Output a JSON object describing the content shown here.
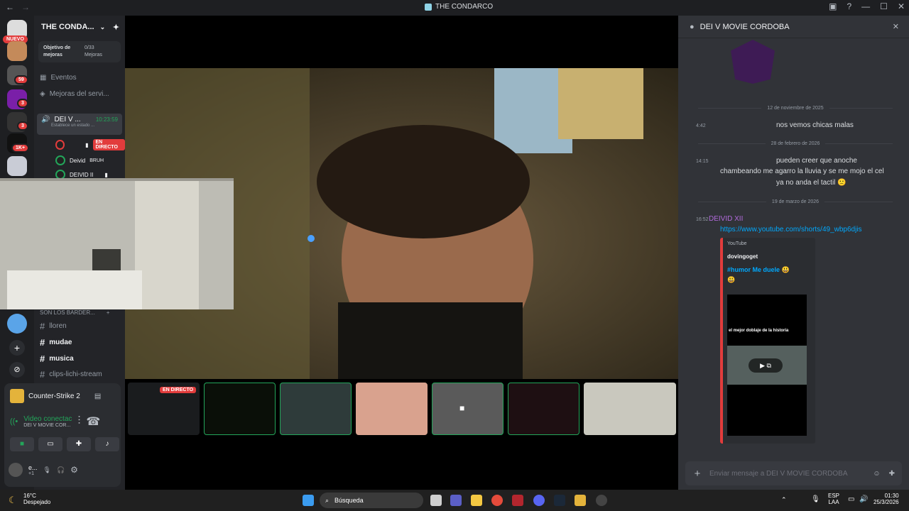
{
  "window": {
    "title": "THE CONDARCO"
  },
  "guilds": {
    "nuevo_label": "NUEVO",
    "badges": [
      "59",
      "3",
      "3",
      "1K+"
    ]
  },
  "server": {
    "name": "THE CONDA...",
    "boost_title": "Objetivo de mejoras",
    "boost_count": "0/33",
    "boost_unit": "Mejoras",
    "events": "Eventos",
    "upgrades": "Mejoras del servi...",
    "voice_channel": "DEI V ...",
    "voice_time": "10:23:59",
    "voice_status": "Establece un estado ...",
    "live_label": "EN DIRECTO",
    "members": [
      {
        "name": "Deivid",
        "status": "BRUH"
      },
      {
        "name": "DEIVID II",
        "status": ""
      }
    ],
    "category": "SON LOS BARDER...",
    "text_channels": [
      "lloren",
      "mudae",
      "musica",
      "clips-lichi-stream"
    ]
  },
  "activity": {
    "game": "Counter-Strike 2"
  },
  "voice_panel": {
    "status": "Video conectac",
    "channel": "DEI V MOVIE COR..."
  },
  "user": {
    "name": "e...",
    "sub": "+1"
  },
  "stage": {
    "thumb_live": "EN DIRECTO"
  },
  "chat": {
    "title": "DEI V MOVIE CORDOBA",
    "date1": "12 de noviembre de 2025",
    "msg1_time": "4:42",
    "msg1_text": "nos vemos chicas malas",
    "date2": "28 de febrero de 2026",
    "msg2_time": "14:15",
    "msg2_line1": "pueden creer que anoche",
    "msg2_line2": "chambeando me agarro la lluvia y se me mojo el cel",
    "msg2_line3": "ya no anda el tactil 🙁",
    "date3": "19 de marzo de 2026",
    "msg3_time": "16:52",
    "msg3_author": "DEIVID XII",
    "msg3_link": "https://www.youtube.com/shorts/49_wbp6djis",
    "embed_provider": "YouTube",
    "embed_author": "dovingoget",
    "embed_title": "#humor Me duele 😃",
    "embed_emoji": "😃",
    "embed_caption": "el mejor doblaje de la historia",
    "input_placeholder": "Enviar mensaje a DEI V MOVIE CORDOBA"
  },
  "taskbar": {
    "temp": "16°C",
    "weather": "Despejado",
    "search": "Búsqueda",
    "lang1": "ESP",
    "lang2": "LAA",
    "time": "01:30",
    "date": "25/3/2026"
  }
}
